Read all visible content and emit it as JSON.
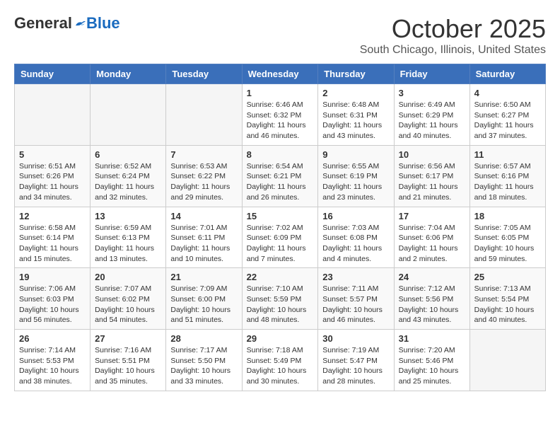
{
  "header": {
    "logo_general": "General",
    "logo_blue": "Blue",
    "month_title": "October 2025",
    "location": "South Chicago, Illinois, United States"
  },
  "days_of_week": [
    "Sunday",
    "Monday",
    "Tuesday",
    "Wednesday",
    "Thursday",
    "Friday",
    "Saturday"
  ],
  "weeks": [
    [
      {
        "day": "",
        "info": ""
      },
      {
        "day": "",
        "info": ""
      },
      {
        "day": "",
        "info": ""
      },
      {
        "day": "1",
        "info": "Sunrise: 6:46 AM\nSunset: 6:32 PM\nDaylight: 11 hours and 46 minutes."
      },
      {
        "day": "2",
        "info": "Sunrise: 6:48 AM\nSunset: 6:31 PM\nDaylight: 11 hours and 43 minutes."
      },
      {
        "day": "3",
        "info": "Sunrise: 6:49 AM\nSunset: 6:29 PM\nDaylight: 11 hours and 40 minutes."
      },
      {
        "day": "4",
        "info": "Sunrise: 6:50 AM\nSunset: 6:27 PM\nDaylight: 11 hours and 37 minutes."
      }
    ],
    [
      {
        "day": "5",
        "info": "Sunrise: 6:51 AM\nSunset: 6:26 PM\nDaylight: 11 hours and 34 minutes."
      },
      {
        "day": "6",
        "info": "Sunrise: 6:52 AM\nSunset: 6:24 PM\nDaylight: 11 hours and 32 minutes."
      },
      {
        "day": "7",
        "info": "Sunrise: 6:53 AM\nSunset: 6:22 PM\nDaylight: 11 hours and 29 minutes."
      },
      {
        "day": "8",
        "info": "Sunrise: 6:54 AM\nSunset: 6:21 PM\nDaylight: 11 hours and 26 minutes."
      },
      {
        "day": "9",
        "info": "Sunrise: 6:55 AM\nSunset: 6:19 PM\nDaylight: 11 hours and 23 minutes."
      },
      {
        "day": "10",
        "info": "Sunrise: 6:56 AM\nSunset: 6:17 PM\nDaylight: 11 hours and 21 minutes."
      },
      {
        "day": "11",
        "info": "Sunrise: 6:57 AM\nSunset: 6:16 PM\nDaylight: 11 hours and 18 minutes."
      }
    ],
    [
      {
        "day": "12",
        "info": "Sunrise: 6:58 AM\nSunset: 6:14 PM\nDaylight: 11 hours and 15 minutes."
      },
      {
        "day": "13",
        "info": "Sunrise: 6:59 AM\nSunset: 6:13 PM\nDaylight: 11 hours and 13 minutes."
      },
      {
        "day": "14",
        "info": "Sunrise: 7:01 AM\nSunset: 6:11 PM\nDaylight: 11 hours and 10 minutes."
      },
      {
        "day": "15",
        "info": "Sunrise: 7:02 AM\nSunset: 6:09 PM\nDaylight: 11 hours and 7 minutes."
      },
      {
        "day": "16",
        "info": "Sunrise: 7:03 AM\nSunset: 6:08 PM\nDaylight: 11 hours and 4 minutes."
      },
      {
        "day": "17",
        "info": "Sunrise: 7:04 AM\nSunset: 6:06 PM\nDaylight: 11 hours and 2 minutes."
      },
      {
        "day": "18",
        "info": "Sunrise: 7:05 AM\nSunset: 6:05 PM\nDaylight: 10 hours and 59 minutes."
      }
    ],
    [
      {
        "day": "19",
        "info": "Sunrise: 7:06 AM\nSunset: 6:03 PM\nDaylight: 10 hours and 56 minutes."
      },
      {
        "day": "20",
        "info": "Sunrise: 7:07 AM\nSunset: 6:02 PM\nDaylight: 10 hours and 54 minutes."
      },
      {
        "day": "21",
        "info": "Sunrise: 7:09 AM\nSunset: 6:00 PM\nDaylight: 10 hours and 51 minutes."
      },
      {
        "day": "22",
        "info": "Sunrise: 7:10 AM\nSunset: 5:59 PM\nDaylight: 10 hours and 48 minutes."
      },
      {
        "day": "23",
        "info": "Sunrise: 7:11 AM\nSunset: 5:57 PM\nDaylight: 10 hours and 46 minutes."
      },
      {
        "day": "24",
        "info": "Sunrise: 7:12 AM\nSunset: 5:56 PM\nDaylight: 10 hours and 43 minutes."
      },
      {
        "day": "25",
        "info": "Sunrise: 7:13 AM\nSunset: 5:54 PM\nDaylight: 10 hours and 40 minutes."
      }
    ],
    [
      {
        "day": "26",
        "info": "Sunrise: 7:14 AM\nSunset: 5:53 PM\nDaylight: 10 hours and 38 minutes."
      },
      {
        "day": "27",
        "info": "Sunrise: 7:16 AM\nSunset: 5:51 PM\nDaylight: 10 hours and 35 minutes."
      },
      {
        "day": "28",
        "info": "Sunrise: 7:17 AM\nSunset: 5:50 PM\nDaylight: 10 hours and 33 minutes."
      },
      {
        "day": "29",
        "info": "Sunrise: 7:18 AM\nSunset: 5:49 PM\nDaylight: 10 hours and 30 minutes."
      },
      {
        "day": "30",
        "info": "Sunrise: 7:19 AM\nSunset: 5:47 PM\nDaylight: 10 hours and 28 minutes."
      },
      {
        "day": "31",
        "info": "Sunrise: 7:20 AM\nSunset: 5:46 PM\nDaylight: 10 hours and 25 minutes."
      },
      {
        "day": "",
        "info": ""
      }
    ]
  ]
}
